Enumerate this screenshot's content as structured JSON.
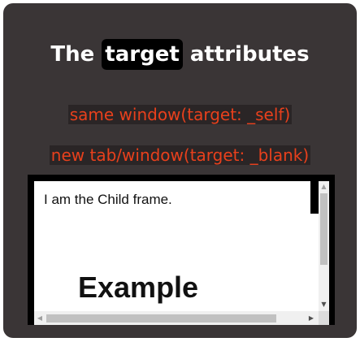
{
  "heading": {
    "prefix": "The ",
    "highlight": "target",
    "suffix": " attributes"
  },
  "links": {
    "self_label": "same window(target: _self)",
    "blank_label": "new tab/window(target: _blank)"
  },
  "iframe": {
    "child_text": "I am the Child frame.",
    "example_heading": "Example"
  },
  "scrollbars": {
    "up_arrow": "▲",
    "down_arrow": "▼",
    "left_arrow": "◀",
    "right_arrow": "▶"
  },
  "colors": {
    "card_bg": "#3a3536",
    "link_color": "#e8401c",
    "title_color": "#ffffff",
    "highlight_bg": "#000000"
  }
}
